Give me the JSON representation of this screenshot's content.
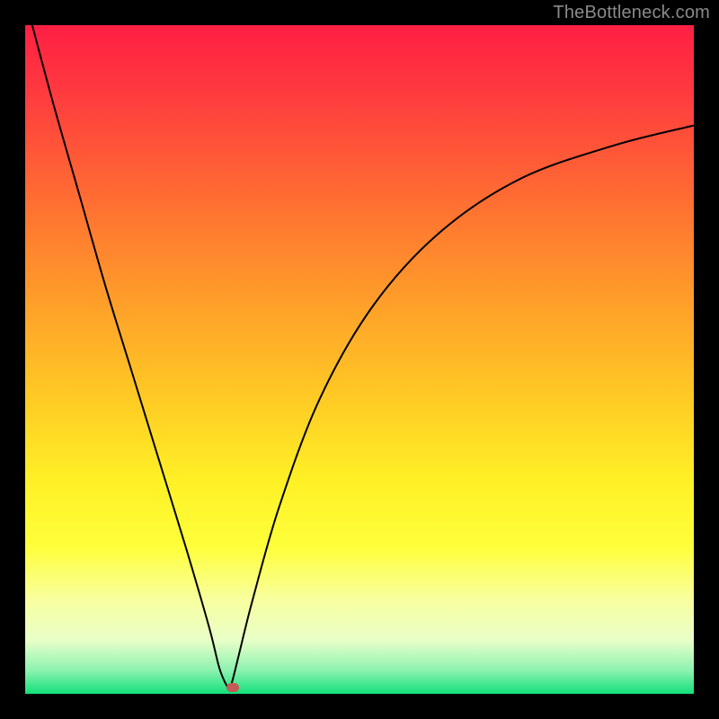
{
  "watermark": "TheBottleneck.com",
  "colors": {
    "frame": "#000000",
    "curve": "#000000",
    "marker": "#c45a56",
    "gradient_stops": [
      {
        "offset": 0.0,
        "color": "#ff1f44"
      },
      {
        "offset": 0.1,
        "color": "#ff3a3f"
      },
      {
        "offset": 0.25,
        "color": "#ff6a33"
      },
      {
        "offset": 0.4,
        "color": "#ff9a2a"
      },
      {
        "offset": 0.55,
        "color": "#ffc824"
      },
      {
        "offset": 0.68,
        "color": "#fff026"
      },
      {
        "offset": 0.78,
        "color": "#feff3a"
      },
      {
        "offset": 0.86,
        "color": "#f8ffa0"
      },
      {
        "offset": 0.92,
        "color": "#e8ffc8"
      },
      {
        "offset": 0.965,
        "color": "#8cf2b0"
      },
      {
        "offset": 1.0,
        "color": "#12e07a"
      }
    ]
  },
  "chart_data": {
    "type": "line",
    "title": "",
    "xlabel": "",
    "ylabel": "",
    "xlim": [
      0,
      100
    ],
    "ylim": [
      0,
      100
    ],
    "grid": false,
    "series": [
      {
        "name": "bottleneck-curve",
        "x": [
          0,
          4,
          8,
          12,
          16,
          20,
          24,
          27.5,
          29,
          30,
          30.5,
          31,
          32,
          34,
          38,
          44,
          52,
          62,
          74,
          88,
          100
        ],
        "y": [
          104,
          89,
          75,
          61,
          48,
          35,
          22,
          10,
          4,
          1.5,
          1,
          2,
          6,
          14,
          28,
          44,
          58,
          69,
          77,
          82,
          85
        ]
      }
    ],
    "marker": {
      "x": 31,
      "y": 1
    },
    "notes": "y represents bottleneck percentage (higher = worse, red zone). Minimum near x≈30.5 indicates balanced configuration (green)."
  }
}
